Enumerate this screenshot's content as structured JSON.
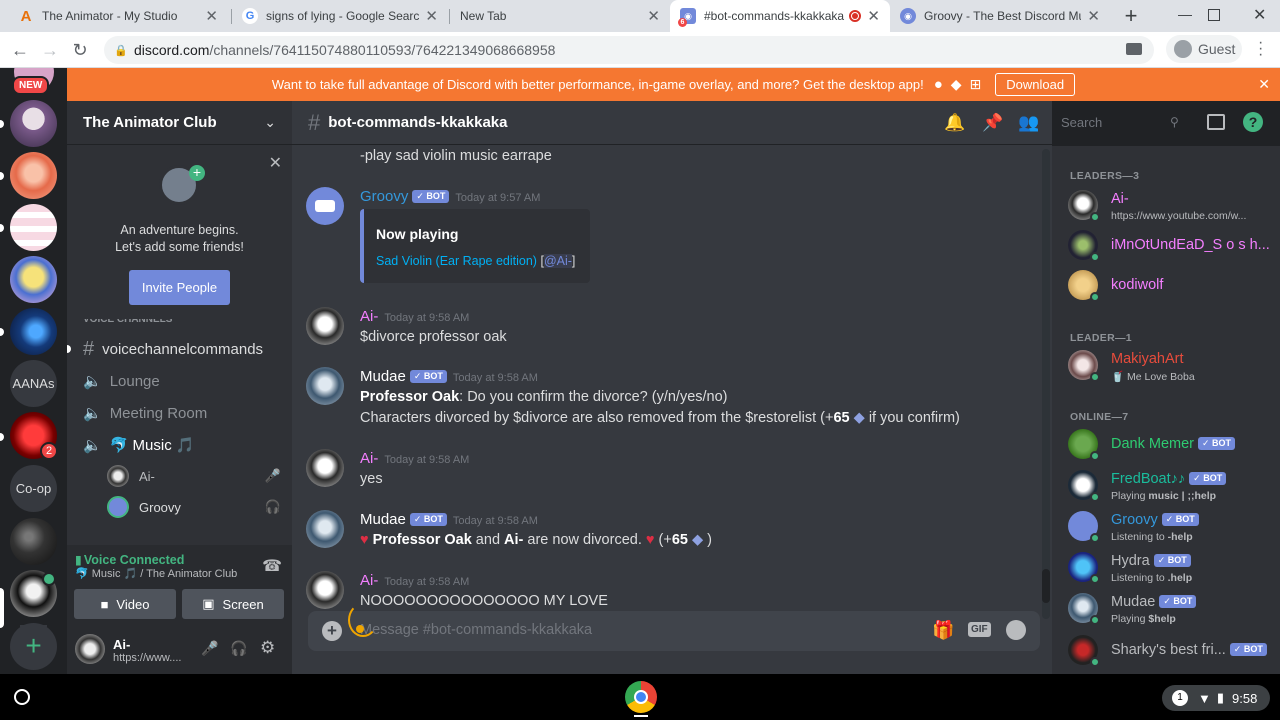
{
  "browser": {
    "tabs": [
      {
        "title": "The Animator - My Studio",
        "close": "✕"
      },
      {
        "title": "signs of lying - Google Search",
        "close": "✕"
      },
      {
        "title": "New Tab",
        "close": "✕"
      },
      {
        "title": "#bot-commands-kkakkaka",
        "close": "✕"
      },
      {
        "title": "Groovy - The Best Discord Music",
        "close": "✕"
      }
    ],
    "url_host": "discord.com",
    "url_path": "/channels/764115074880110593/764221349068668958",
    "profile_label": "Guest"
  },
  "banner": {
    "text": "Want to take full advantage of Discord with better performance, in-game overlay, and more? Get the desktop app!",
    "download_label": "Download"
  },
  "guilds": {
    "new_badge": "NEW",
    "text_servers": [
      "AANAs",
      "Co-op"
    ],
    "mention_count": "2"
  },
  "server": {
    "name": "The Animator Club",
    "onboarding": {
      "title": "An adventure begins.",
      "subtitle": "Let's add some friends!",
      "invite_label": "Invite People"
    },
    "category_label": "VOICE CHANNELS",
    "channels": [
      {
        "name": "voicechannelcommands",
        "type": "text"
      },
      {
        "name": "Lounge",
        "type": "voice"
      },
      {
        "name": "Meeting Room",
        "type": "voice"
      },
      {
        "name": "🐬 Music 🎵",
        "type": "voice"
      }
    ],
    "voice_users": [
      "Ai-",
      "Groovy"
    ],
    "voice_connected": {
      "status": "Voice Connected",
      "location": "🐬 Music 🎵 / The Animator Club",
      "video_label": "Video",
      "screen_label": "Screen"
    },
    "user_panel": {
      "name": "Ai-",
      "status": "https://www...."
    }
  },
  "chat": {
    "channel_name": "bot-commands-kkakkaka",
    "search_placeholder": "Search",
    "composer_placeholder": "Message #bot-commands-kkakkaka",
    "gif_label": "GIF",
    "prev_line": "-play sad violin music earrape",
    "messages": [
      {
        "author": "Groovy",
        "bot": true,
        "time": "Today at 9:57 AM"
      },
      {
        "author": "Ai-",
        "bot": false,
        "time": "Today at 9:58 AM",
        "text": "$divorce professor oak"
      },
      {
        "author": "Mudae",
        "bot": true,
        "time": "Today at 9:58 AM"
      },
      {
        "author": "Ai-",
        "bot": false,
        "time": "Today at 9:58 AM",
        "text": "yes"
      },
      {
        "author": "Mudae",
        "bot": true,
        "time": "Today at 9:58 AM"
      },
      {
        "author": "Ai-",
        "bot": false,
        "time": "Today at 9:58 AM",
        "text": "NOOOOOOOOOOOOOOO MY LOVE"
      }
    ],
    "bot_tag": "✓ BOT",
    "embed": {
      "title": "Now playing",
      "track": "Sad Violin (Ear Rape edition)",
      "mention": "@Ai-",
      "open": "[",
      "close": "]"
    },
    "mudae1": {
      "bold": "Professor Oak",
      "q": ": Do you confirm the divorce? (y/n/yes/no)",
      "l2a": "Characters divorced by $divorce are also removed from the $restorelist (+",
      "l2b": "65",
      "l2c": " if you confirm)"
    },
    "mudae2": {
      "a": "Professor Oak",
      "and": " and ",
      "b": "Ai-",
      "rest": " are now divorced.",
      "plus": " (+",
      "num": "65",
      "end": " )"
    }
  },
  "members": {
    "sections": [
      {
        "title": "LEADERS—3"
      },
      {
        "title": "LEADER—1"
      },
      {
        "title": "ONLINE—7"
      }
    ],
    "leaders": [
      {
        "name": "Ai-",
        "sub": "https://www.youtube.com/w...",
        "color": "#f47fff"
      },
      {
        "name": "iMnOtUndEaD_S o s h...",
        "sub": "",
        "color": "#f47fff"
      },
      {
        "name": "kodiwolf",
        "sub": "",
        "color": "#f47fff"
      }
    ],
    "leader": [
      {
        "name": "MakiyahArt",
        "sub": "🥤 Me Love Boba",
        "color": "#e74c3c"
      }
    ],
    "online": [
      {
        "name": "Dank Memer",
        "sub": "",
        "bot": true,
        "color": "#2ecc71",
        "sub_bold": ""
      },
      {
        "name": "FredBoat♪♪",
        "sub": "Playing ",
        "bot": true,
        "color": "#1abc9c",
        "sub_bold": "music | ;;help"
      },
      {
        "name": "Groovy",
        "sub": "Listening to ",
        "bot": true,
        "color": "#3498db",
        "sub_bold": "-help"
      },
      {
        "name": "Hydra",
        "sub": "Listening to ",
        "bot": true,
        "color": "#b9bbbe",
        "sub_bold": ".help"
      },
      {
        "name": "Mudae",
        "sub": "Playing ",
        "bot": true,
        "color": "#b9bbbe",
        "sub_bold": "$help"
      },
      {
        "name": "Sharky's best fri...",
        "sub": "",
        "bot": true,
        "color": "#b9bbbe",
        "sub_bold": ""
      }
    ]
  },
  "taskbar": {
    "notif_count": "1",
    "time": "9:58"
  },
  "colors": {
    "blurple": "#7289da",
    "banner": "#f57731",
    "green": "#43b581",
    "red": "#f04747"
  }
}
